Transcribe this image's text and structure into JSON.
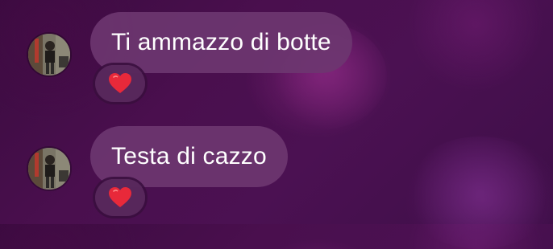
{
  "messages": [
    {
      "text": "Ti ammazzo di botte",
      "reaction": "red-heart-icon"
    },
    {
      "text": "Testa di cazzo",
      "reaction": "red-heart-icon"
    }
  ],
  "colors": {
    "background": "#45104a",
    "bubble": "#6c3670",
    "reaction_pill": "#58285c",
    "heart": "#e8293a",
    "text": "#ffffff"
  }
}
